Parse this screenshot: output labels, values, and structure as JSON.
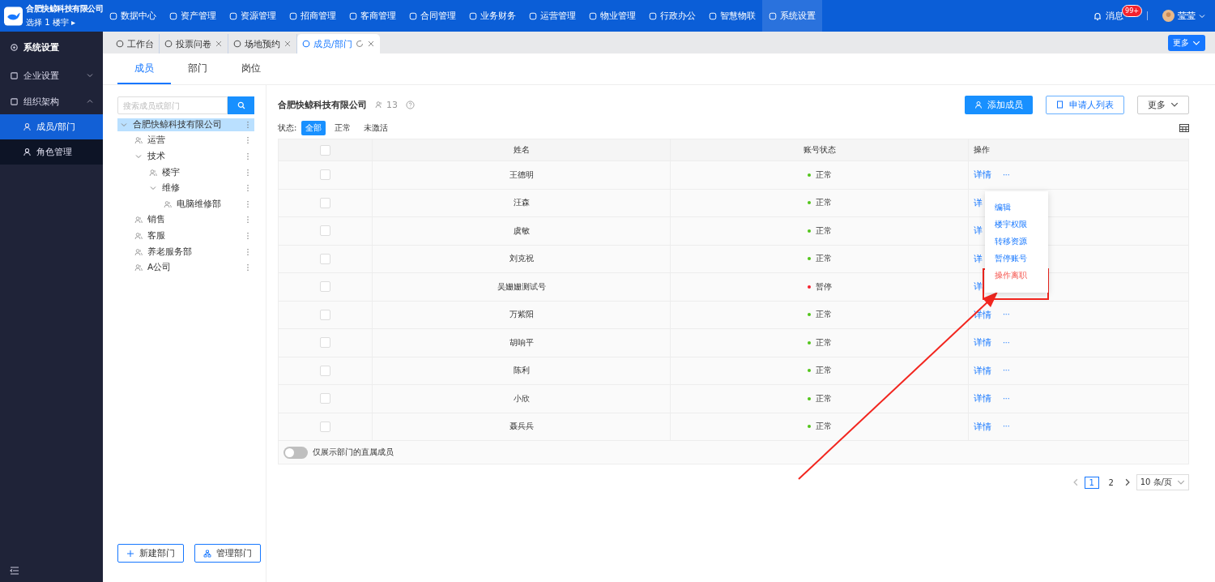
{
  "brand": {
    "company": "合肥快鲸科技有限公司",
    "building": "选择 1 楼宇 ▸"
  },
  "nav": [
    {
      "label": "数据中心",
      "selected": false
    },
    {
      "label": "资产管理",
      "selected": false
    },
    {
      "label": "资源管理",
      "selected": false
    },
    {
      "label": "招商管理",
      "selected": false
    },
    {
      "label": "客商管理",
      "selected": false
    },
    {
      "label": "合同管理",
      "selected": false
    },
    {
      "label": "业务财务",
      "selected": false
    },
    {
      "label": "运营管理",
      "selected": false
    },
    {
      "label": "物业管理",
      "selected": false
    },
    {
      "label": "行政办公",
      "selected": false
    },
    {
      "label": "智慧物联",
      "selected": false
    },
    {
      "label": "系统设置",
      "selected": true
    }
  ],
  "header_right": {
    "messages": "消息",
    "badge": "99+",
    "user": "莹莹"
  },
  "sidebar": {
    "title": "系统设置",
    "items": [
      {
        "label": "企业设置",
        "expanded": false
      },
      {
        "label": "组织架构",
        "expanded": true,
        "children": [
          {
            "label": "成员/部门",
            "selected": true
          },
          {
            "label": "角色管理",
            "selected": false
          }
        ]
      }
    ]
  },
  "page_tabs": [
    {
      "label": "工作台",
      "selected": false,
      "closable": false
    },
    {
      "label": "投票问卷",
      "selected": false,
      "closable": true
    },
    {
      "label": "场地预约",
      "selected": false,
      "closable": true
    },
    {
      "label": "成员/部门",
      "selected": true,
      "closable": true
    }
  ],
  "more_button": "更多",
  "sub_tabs": [
    {
      "label": "成员",
      "selected": true
    },
    {
      "label": "部门",
      "selected": false
    },
    {
      "label": "岗位",
      "selected": false
    }
  ],
  "dept_search": {
    "placeholder": "搜索成员或部门"
  },
  "tree": [
    {
      "label": "合肥快鲸科技有限公司",
      "selected": true,
      "expanded": true,
      "children": [
        {
          "label": "运营",
          "selected": false
        },
        {
          "label": "技术",
          "selected": false,
          "expanded": true,
          "children": [
            {
              "label": "楼宇",
              "selected": false
            },
            {
              "label": "维修",
              "selected": false,
              "expanded": true,
              "children": [
                {
                  "label": "电脑维修部",
                  "selected": false
                }
              ]
            }
          ]
        },
        {
          "label": "销售",
          "selected": false
        },
        {
          "label": "客服",
          "selected": false
        },
        {
          "label": "养老服务部",
          "selected": false
        },
        {
          "label": "A公司",
          "selected": false
        }
      ]
    }
  ],
  "tree_buttons": [
    "新建部门",
    "管理部门"
  ],
  "org": {
    "name": "合肥快鲸科技有限公司",
    "count": "13"
  },
  "actions": [
    "添加成员",
    "申请人列表",
    "更多"
  ],
  "filter": {
    "label": "状态:",
    "options": [
      {
        "label": "全部",
        "selected": true
      },
      {
        "label": "正常",
        "selected": false
      },
      {
        "label": "未激活",
        "selected": false
      }
    ]
  },
  "table": {
    "all_checked": false,
    "columns": [
      "姓名",
      "账号状态",
      "操作"
    ],
    "rows": [
      {
        "checked": false,
        "name": "王德明",
        "status": "正常",
        "active": true,
        "detail": "详情",
        "more": "···"
      },
      {
        "checked": false,
        "name": "汪森",
        "status": "正常",
        "active": true,
        "detail": "详"
      },
      {
        "checked": false,
        "name": "虞敏",
        "status": "正常",
        "active": true,
        "detail": "详"
      },
      {
        "checked": false,
        "name": "刘克祝",
        "status": "正常",
        "active": true,
        "detail": "详"
      },
      {
        "checked": false,
        "name": "吴姗姗测试号",
        "status": "暂停",
        "active": false,
        "detail": "详"
      },
      {
        "checked": false,
        "name": "万紫阳",
        "status": "正常",
        "active": true,
        "detail": "详情",
        "more": "···"
      },
      {
        "checked": false,
        "name": "胡响平",
        "status": "正常",
        "active": true,
        "detail": "详情",
        "more": "···"
      },
      {
        "checked": false,
        "name": "陈利",
        "status": "正常",
        "active": true,
        "detail": "详情",
        "more": "···"
      },
      {
        "checked": false,
        "name": "小欣",
        "status": "正常",
        "active": true,
        "detail": "详情",
        "more": "···"
      },
      {
        "checked": false,
        "name": "聂兵兵",
        "status": "正常",
        "active": true,
        "detail": "详情",
        "more": "···"
      }
    ]
  },
  "row_menu": [
    {
      "label": "编辑",
      "kind": "normal"
    },
    {
      "label": "楼宇权限",
      "kind": "normal"
    },
    {
      "label": "转移资源",
      "kind": "normal"
    },
    {
      "label": "暂停账号",
      "kind": "normal"
    },
    {
      "label": "操作离职",
      "kind": "danger"
    }
  ],
  "direct_only": {
    "label": "仅展示部门的直属成员",
    "on": false
  },
  "pagination": {
    "pages": [
      {
        "label": "1",
        "selected": true
      },
      {
        "label": "2",
        "selected": false
      }
    ],
    "size": "10 条/页"
  }
}
